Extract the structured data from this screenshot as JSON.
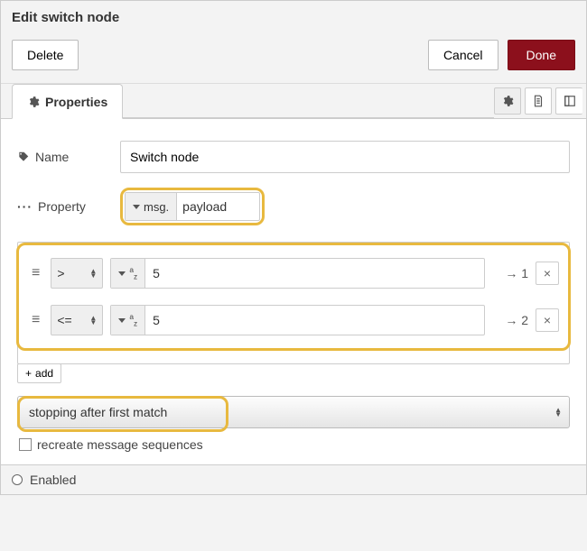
{
  "header": {
    "title": "Edit switch node"
  },
  "toolbar": {
    "delete_label": "Delete",
    "cancel_label": "Cancel",
    "done_label": "Done"
  },
  "tabs": {
    "properties_label": "Properties"
  },
  "form": {
    "name_label": "Name",
    "name_value": "Switch node",
    "property_label": "Property",
    "property_type": "msg.",
    "property_value": "payload"
  },
  "rules": [
    {
      "operator": ">",
      "value_type": "az",
      "value": "5",
      "output": "1"
    },
    {
      "operator": "<=",
      "value_type": "az",
      "value": "5",
      "output": "2"
    }
  ],
  "add_label": "add",
  "match_mode": "stopping after first match",
  "recreate_label": "recreate message sequences",
  "footer": {
    "enabled_label": "Enabled"
  },
  "icons": {
    "arrow": "→",
    "close": "×",
    "plus": "+",
    "dots": "···",
    "hamburger": "≡"
  }
}
